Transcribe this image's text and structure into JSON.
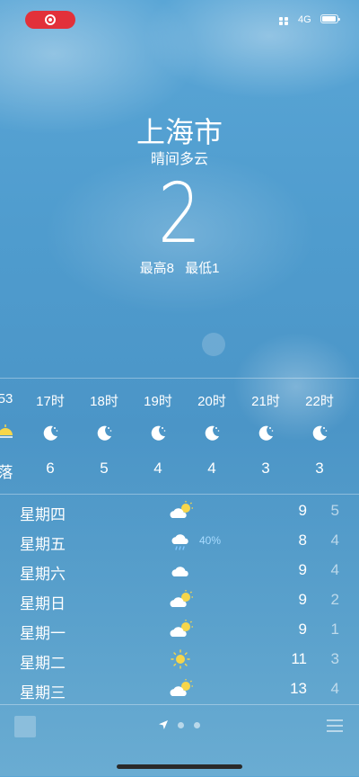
{
  "status_bar": {
    "network": "4G"
  },
  "current": {
    "city": "上海市",
    "condition": "晴间多云",
    "temperature": "2",
    "high": "最高8",
    "low": "最低1"
  },
  "hourly": [
    {
      "time": "53",
      "icon": "sun-partial-icon",
      "value": "落"
    },
    {
      "time": "17时",
      "icon": "moon-icon",
      "value": "6"
    },
    {
      "time": "18时",
      "icon": "moon-icon",
      "value": "5"
    },
    {
      "time": "19时",
      "icon": "moon-icon",
      "value": "4"
    },
    {
      "time": "20时",
      "icon": "moon-icon",
      "value": "4"
    },
    {
      "time": "21时",
      "icon": "moon-icon",
      "value": "3"
    },
    {
      "time": "22时",
      "icon": "moon-icon",
      "value": "3"
    }
  ],
  "daily": [
    {
      "day": "星期四",
      "icon": "partly-cloudy-icon",
      "precip": "",
      "high": "9",
      "low": "5"
    },
    {
      "day": "星期五",
      "icon": "rain-cloud-icon",
      "precip": "40%",
      "high": "8",
      "low": "4"
    },
    {
      "day": "星期六",
      "icon": "cloud-icon",
      "precip": "",
      "high": "9",
      "low": "4"
    },
    {
      "day": "星期日",
      "icon": "partly-cloudy-icon",
      "precip": "",
      "high": "9",
      "low": "2"
    },
    {
      "day": "星期一",
      "icon": "partly-cloudy-icon",
      "precip": "",
      "high": "9",
      "low": "1"
    },
    {
      "day": "星期二",
      "icon": "sun-icon",
      "precip": "",
      "high": "11",
      "low": "3"
    },
    {
      "day": "星期三",
      "icon": "partly-cloudy-icon",
      "precip": "",
      "high": "13",
      "low": "4"
    }
  ],
  "colors": {
    "recording": "#e2313a",
    "precip": "#a9dcff",
    "sun": "#f7d64a"
  }
}
